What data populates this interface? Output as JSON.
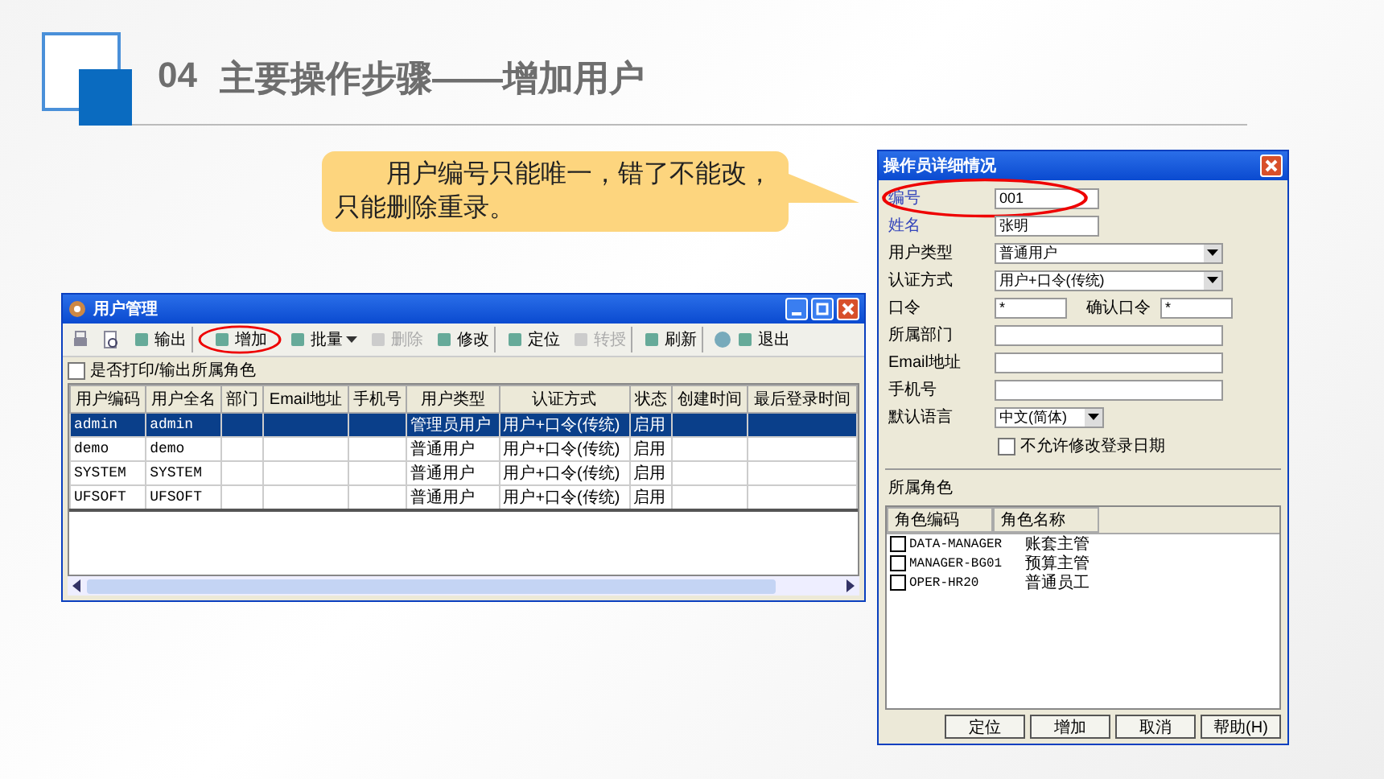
{
  "slide": {
    "number": "04",
    "title": "主要操作步骤——增加用户"
  },
  "callout": {
    "text": "用户编号只能唯一，错了不能改，只能删除重录。"
  },
  "user_window": {
    "title": "用户管理",
    "toolbar": [
      {
        "label": "输出",
        "disabled": false,
        "highlighted": false,
        "has_menu": false,
        "separator_after": true
      },
      {
        "label": "增加",
        "disabled": false,
        "highlighted": true,
        "has_menu": false,
        "separator_after": false
      },
      {
        "label": "批量",
        "disabled": false,
        "highlighted": false,
        "has_menu": true,
        "separator_after": false
      },
      {
        "label": "删除",
        "disabled": true,
        "highlighted": false,
        "has_menu": false,
        "separator_after": false
      },
      {
        "label": "修改",
        "disabled": false,
        "highlighted": false,
        "has_menu": false,
        "separator_after": true
      },
      {
        "label": "定位",
        "disabled": false,
        "highlighted": false,
        "has_menu": false,
        "separator_after": false
      },
      {
        "label": "转授",
        "disabled": true,
        "highlighted": false,
        "has_menu": false,
        "separator_after": true
      },
      {
        "label": "刷新",
        "disabled": false,
        "highlighted": false,
        "has_menu": false,
        "separator_after": true
      },
      {
        "label": "退出",
        "disabled": false,
        "highlighted": false,
        "has_menu": false,
        "separator_after": false
      }
    ],
    "option": {
      "label": "是否打印/输出所属角色",
      "checked": false
    },
    "table": {
      "columns": [
        "用户编码",
        "用户全名",
        "部门",
        "Email地址",
        "手机号",
        "用户类型",
        "认证方式",
        "状态",
        "创建时间",
        "最后登录时间"
      ],
      "rows": [
        {
          "cells": [
            "admin",
            "admin",
            "",
            "",
            "",
            "管理员用户",
            "用户+口令(传统)",
            "启用",
            "",
            ""
          ],
          "selected": true
        },
        {
          "cells": [
            "demo",
            "demo",
            "",
            "",
            "",
            "普通用户",
            "用户+口令(传统)",
            "启用",
            "",
            ""
          ],
          "selected": false
        },
        {
          "cells": [
            "SYSTEM",
            "SYSTEM",
            "",
            "",
            "",
            "普通用户",
            "用户+口令(传统)",
            "启用",
            "",
            ""
          ],
          "selected": false
        },
        {
          "cells": [
            "UFSOFT",
            "UFSOFT",
            "",
            "",
            "",
            "普通用户",
            "用户+口令(传统)",
            "启用",
            "",
            ""
          ],
          "selected": false
        }
      ]
    }
  },
  "detail_dialog": {
    "title": "操作员详细情况",
    "fields": [
      {
        "kind": "text",
        "label": "编号",
        "value": "001",
        "required": true,
        "highlighted": true
      },
      {
        "kind": "text",
        "label": "姓名",
        "value": "张明",
        "required": true,
        "highlighted": false
      },
      {
        "kind": "select",
        "label": "用户类型",
        "value": "普通用户",
        "required": false,
        "highlighted": false
      },
      {
        "kind": "select",
        "label": "认证方式",
        "value": "用户+口令(传统)",
        "required": false,
        "highlighted": false
      },
      {
        "kind": "pair",
        "label": "口令",
        "value": "*",
        "label_2": "确认口令",
        "value_2": "*",
        "required": false,
        "highlighted": false
      },
      {
        "kind": "text",
        "label": "所属部门",
        "required": false,
        "highlighted": false
      },
      {
        "kind": "text",
        "label": "Email地址",
        "required": false,
        "highlighted": false
      },
      {
        "kind": "text",
        "label": "手机号",
        "required": false,
        "highlighted": false
      },
      {
        "kind": "short-select",
        "label": "默认语言",
        "value": "中文(简体)",
        "required": false,
        "highlighted": false
      }
    ],
    "option": {
      "label": "不允许修改登录日期",
      "checked": false
    },
    "roles": {
      "label": "所属角色",
      "columns": [
        "角色编码",
        "角色名称"
      ],
      "rows": [
        {
          "code": "DATA-MANAGER",
          "name": "账套主管",
          "checked": false
        },
        {
          "code": "MANAGER-BG01",
          "name": "预算主管",
          "checked": false
        },
        {
          "code": "OPER-HR20",
          "name": "普通员工",
          "checked": false
        }
      ]
    },
    "buttons": [
      "定位",
      "增加",
      "取消",
      "帮助(H)"
    ]
  }
}
